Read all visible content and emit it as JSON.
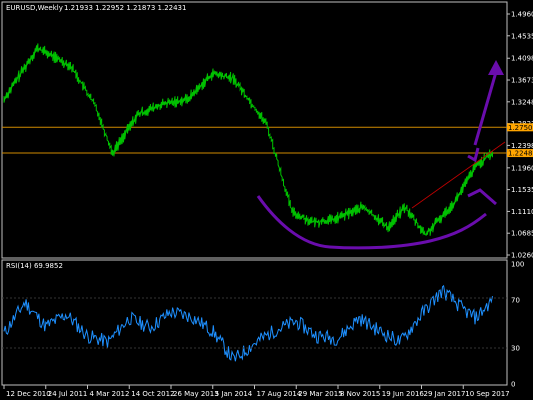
{
  "window": {
    "title": "EURUSD,Weekly",
    "ohlc": "1.21933 1.22952 1.21873 1.22431"
  },
  "indicator": {
    "label": "RSI(14) 69.9852"
  },
  "colors": {
    "background": "#000000",
    "frame": "#c0c0c0",
    "price_line": "#00c000",
    "rsi_line": "#1e90ff",
    "horizontal_level": "#d08a00",
    "current_price_line": "#d08a00",
    "price_tag_bg": "#ffa500",
    "drawing": "#6a0dad",
    "trendline": "#c00000"
  },
  "chart_data": [
    {
      "type": "line",
      "title": "EURUSD,Weekly",
      "x": [
        "12 Dec 2010",
        "24 Jul 2011",
        "4 Mar 2012",
        "14 Oct 2012",
        "26 May 2013",
        "5 Jan 2014",
        "17 Aug 2014",
        "29 Mar 2015",
        "8 Nov 2015",
        "19 Jun 2016",
        "29 Jan 2017",
        "10 Sep 2017"
      ],
      "series": [
        {
          "values": [
            1.33,
            1.43,
            1.395,
            1.315,
            1.225,
            1.3,
            1.32,
            1.33,
            1.38,
            1.37,
            1.28,
            1.11,
            1.09,
            1.095,
            1.12,
            1.08,
            1.12,
            1.065,
            1.13,
            1.2,
            1.2243
          ],
          "x_index": [
            0,
            0.8,
            1.6,
            2.2,
            2.6,
            3.2,
            3.8,
            4.4,
            5.0,
            5.5,
            6.3,
            6.9,
            7.4,
            7.9,
            8.6,
            9.2,
            9.6,
            10.1,
            10.8,
            11.3,
            11.7
          ]
        }
      ],
      "y_ticks": [
        "1.49605",
        "1.45355",
        "1.40980",
        "1.36730",
        "1.32480",
        "1.28230",
        "1.23980",
        "1.19605",
        "1.15355",
        "1.11105",
        "1.06855",
        "1.02605"
      ],
      "ylim": [
        1.02605,
        1.49605
      ],
      "horizontal_levels": [
        1.27509
      ],
      "level_labels": [
        "1.27509"
      ],
      "current_price": 1.22488,
      "current_price_label": "1.22488",
      "grid": false
    },
    {
      "type": "line",
      "title": "RSI(14) 69.9852",
      "y_ticks": [
        "100",
        "70",
        "30",
        "0"
      ],
      "ylim": [
        0,
        100
      ],
      "x_index": [
        0,
        0.5,
        1,
        1.5,
        2,
        2.5,
        3,
        3.5,
        4,
        4.5,
        5,
        5.5,
        6,
        6.5,
        7,
        7.5,
        8,
        8.5,
        9,
        9.5,
        10,
        10.5,
        11,
        11.3,
        11.7
      ],
      "values": [
        42,
        68,
        48,
        58,
        40,
        35,
        55,
        47,
        60,
        56,
        44,
        20,
        34,
        45,
        52,
        40,
        38,
        55,
        44,
        35,
        58,
        78,
        62,
        55,
        70
      ]
    }
  ]
}
